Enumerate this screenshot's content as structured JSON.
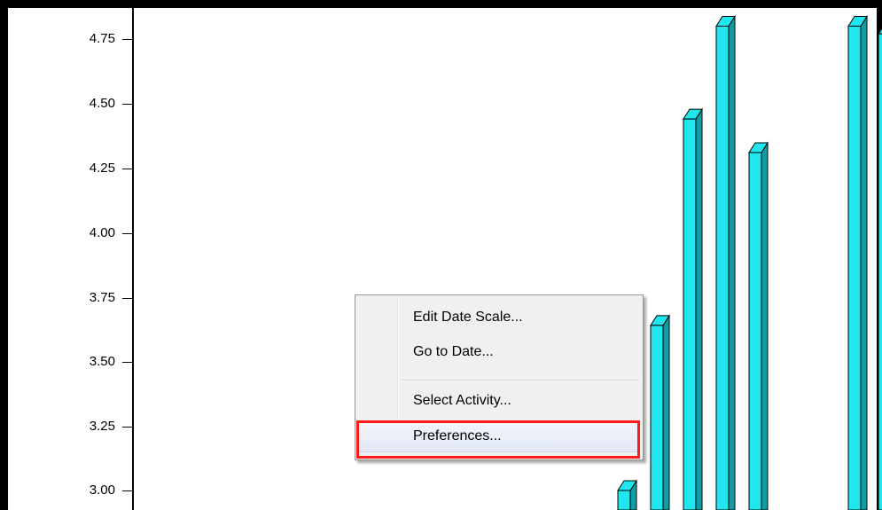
{
  "chart": {
    "bar_color": "#22e6ee",
    "bar_side_color": "#0f9ca3",
    "bar_outline_color": "#000000"
  },
  "chart_data": {
    "type": "bar",
    "title": "",
    "xlabel": "",
    "ylabel": "",
    "ylim": [
      2.98,
      4.8
    ],
    "yticks": [
      "4.75",
      "4.50",
      "4.25",
      "4.00",
      "3.75",
      "3.50",
      "3.25",
      "3.00"
    ],
    "grid": false,
    "values": [
      3.0,
      3.64,
      4.44,
      4.8,
      4.31,
      4.8,
      4.77
    ]
  },
  "context_menu": {
    "items": [
      {
        "label": "Edit Date Scale..."
      },
      {
        "label": "Go to Date..."
      },
      {
        "label": "Select Activity..."
      },
      {
        "label": "Preferences..."
      }
    ],
    "highlight_color": "#ff1a1a"
  }
}
